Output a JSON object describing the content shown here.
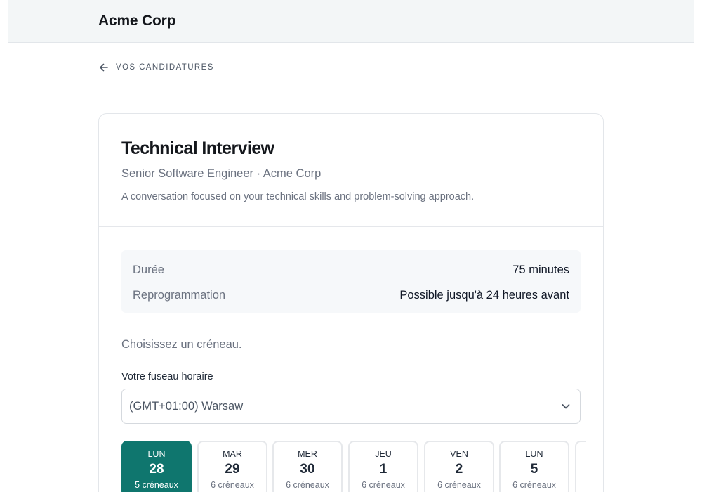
{
  "header": {
    "brand": "Acme Corp"
  },
  "nav": {
    "back_label": "VOS CANDIDATURES"
  },
  "event": {
    "title": "Technical Interview",
    "subtitle": "Senior Software Engineer · Acme Corp",
    "description": "A conversation focused on your technical skills and problem-solving approach."
  },
  "details": [
    {
      "label": "Durée",
      "value": "75 minutes"
    },
    {
      "label": "Reprogrammation",
      "value": "Possible jusqu'à 24 heures avant"
    }
  ],
  "booking": {
    "prompt": "Choisissez un créneau.",
    "timezone_label": "Votre fuseau horaire",
    "timezone_value": "(GMT+01:00) Warsaw"
  },
  "days": [
    {
      "weekday": "LUN",
      "day": "28",
      "slots": "5 créneaux",
      "selected": true
    },
    {
      "weekday": "MAR",
      "day": "29",
      "slots": "6 créneaux",
      "selected": false
    },
    {
      "weekday": "MER",
      "day": "30",
      "slots": "6 créneaux",
      "selected": false
    },
    {
      "weekday": "JEU",
      "day": "1",
      "slots": "6 créneaux",
      "selected": false
    },
    {
      "weekday": "VEN",
      "day": "2",
      "slots": "6 créneaux",
      "selected": false
    },
    {
      "weekday": "LUN",
      "day": "5",
      "slots": "6 créneaux",
      "selected": false
    }
  ],
  "colors": {
    "accent": "#0f766e",
    "header_bg": "#f3f6f7",
    "info_bg": "#f6f8fa"
  },
  "icons": {
    "back": "arrow-left-icon",
    "select": "chevron-down-icon"
  }
}
